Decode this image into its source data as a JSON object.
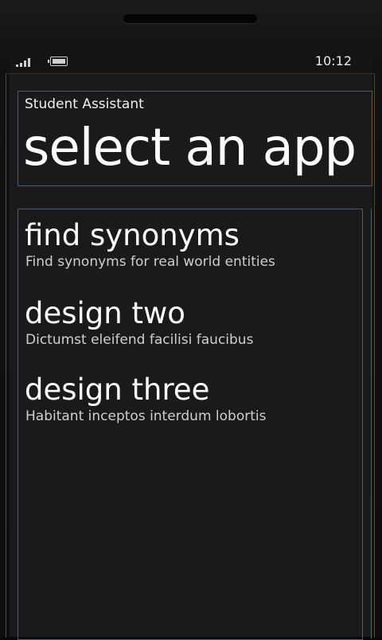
{
  "status_bar": {
    "time": "10:12",
    "signal_icon": "signal-strength-icon",
    "battery_icon": "battery-icon"
  },
  "header": {
    "app_name": "Student Assistant",
    "page_title": "select an app"
  },
  "apps": [
    {
      "title": "find synonyms",
      "subtitle": "Find synonyms for real world entities"
    },
    {
      "title": "design two",
      "subtitle": "Dictumst eleifend facilisi faucibus"
    },
    {
      "title": "design three",
      "subtitle": "Habitant inceptos interdum lobortis"
    }
  ]
}
